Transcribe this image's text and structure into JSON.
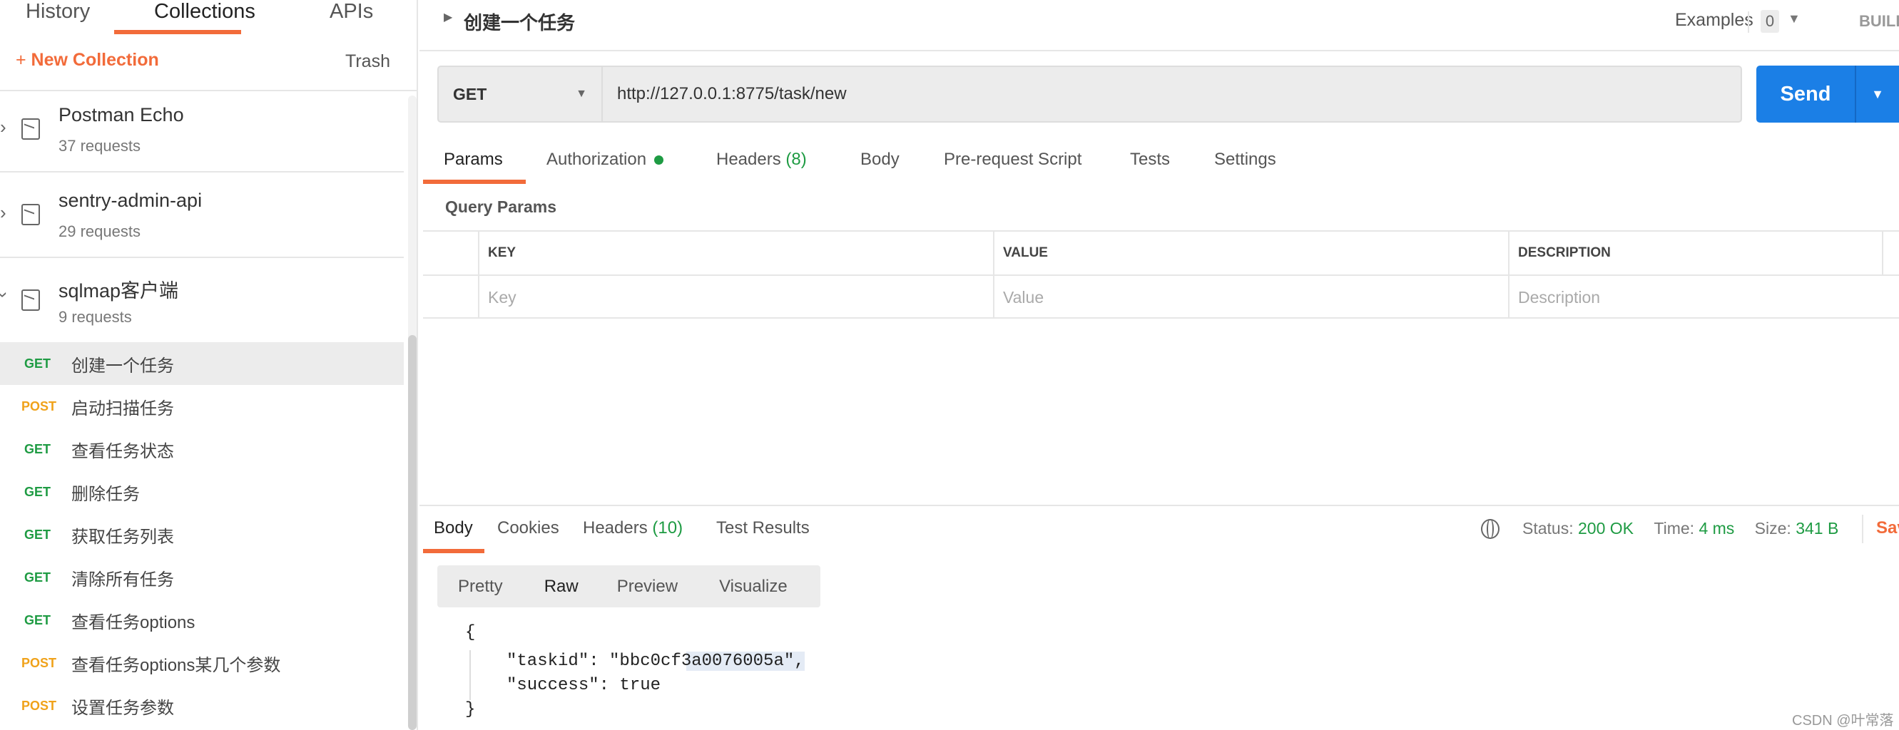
{
  "sidebar": {
    "tabs": [
      "History",
      "Collections",
      "APIs"
    ],
    "new_collection": "New Collection",
    "trash": "Trash",
    "collections": [
      {
        "name": "Postman Echo",
        "count": "37 requests",
        "expanded": false
      },
      {
        "name": "sentry-admin-api",
        "count": "29 requests",
        "expanded": false
      },
      {
        "name": "sqlmap客户端",
        "count": "9 requests",
        "expanded": true
      }
    ],
    "requests": [
      {
        "method": "GET",
        "name": "创建一个任务",
        "selected": true
      },
      {
        "method": "POST",
        "name": "启动扫描任务"
      },
      {
        "method": "GET",
        "name": "查看任务状态"
      },
      {
        "method": "GET",
        "name": "删除任务"
      },
      {
        "method": "GET",
        "name": "获取任务列表"
      },
      {
        "method": "GET",
        "name": "清除所有任务"
      },
      {
        "method": "GET",
        "name": "查看任务options"
      },
      {
        "method": "POST",
        "name": "查看任务options某几个参数"
      },
      {
        "method": "POST",
        "name": "设置任务参数"
      }
    ]
  },
  "header": {
    "title": "创建一个任务",
    "examples_label": "Examples",
    "examples_count": "0",
    "build": "BUILD"
  },
  "request": {
    "method": "GET",
    "url": "http://127.0.0.1:8775/task/new",
    "send": "Send"
  },
  "req_tabs": [
    {
      "label": "Params"
    },
    {
      "label": "Authorization"
    },
    {
      "label": "Headers",
      "count": "(8)"
    },
    {
      "label": "Body"
    },
    {
      "label": "Pre-request Script"
    },
    {
      "label": "Tests"
    },
    {
      "label": "Settings"
    }
  ],
  "query_params": {
    "title": "Query Params",
    "headers": [
      "KEY",
      "VALUE",
      "DESCRIPTION"
    ],
    "placeholders": [
      "Key",
      "Value",
      "Description"
    ]
  },
  "response": {
    "tabs": [
      {
        "label": "Body"
      },
      {
        "label": "Cookies"
      },
      {
        "label": "Headers",
        "count": "(10)"
      },
      {
        "label": "Test Results"
      }
    ],
    "status_label": "Status:",
    "status": "200 OK",
    "time_label": "Time:",
    "time": "4 ms",
    "size_label": "Size:",
    "size": "341 B",
    "save": "Sav",
    "views": [
      "Pretty",
      "Raw",
      "Preview",
      "Visualize"
    ],
    "body_lines": [
      "{",
      "\"taskid\": \"bbc0cf3a0076005a\",",
      "\"success\": true",
      "}"
    ]
  },
  "watermark": "CSDN @叶常落",
  "colors": {
    "accent": "#f26b3a",
    "send": "#1b7fe6",
    "green": "#1e9b43",
    "post": "#f0a21a"
  }
}
